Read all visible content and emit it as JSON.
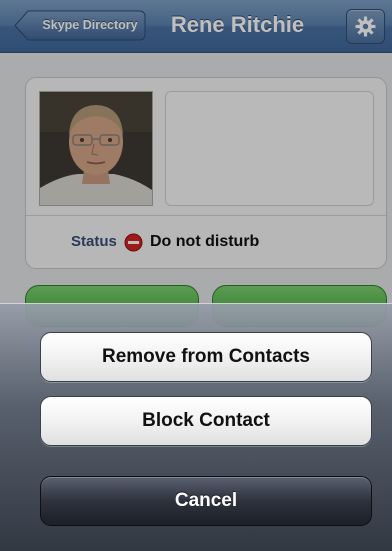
{
  "nav": {
    "back_label": "Skype Directory",
    "title": "Rene Ritchie",
    "settings_icon": "gear-icon"
  },
  "profile": {
    "status_label": "Status",
    "status_icon": "do-not-disturb-icon",
    "status_value": "Do not disturb"
  },
  "action_sheet": {
    "remove_label": "Remove from Contacts",
    "block_label": "Block Contact",
    "cancel_label": "Cancel"
  },
  "colors": {
    "navbar": "#4b72a3",
    "status_dnd": "#d0241f",
    "call_buttons": "#3aa233"
  }
}
